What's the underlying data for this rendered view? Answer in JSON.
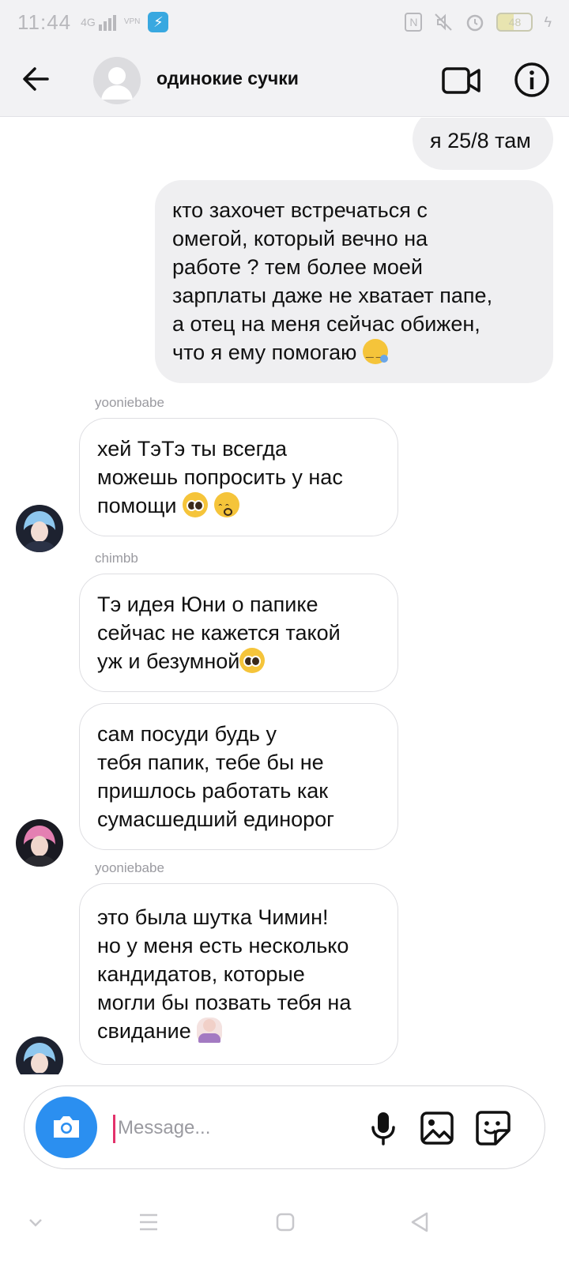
{
  "status_bar": {
    "time": "11:44",
    "signal_label": "4G",
    "vpn_label": "VPN",
    "app_icon": "telegram-x-icon",
    "battery": "48"
  },
  "header": {
    "title": "одинокие сучки",
    "back_icon": "arrow-left-icon",
    "video_icon": "video-camera-icon",
    "info_icon": "info-icon"
  },
  "messages": [
    {
      "type": "sent",
      "lines": [
        "я 25/8 там"
      ]
    },
    {
      "type": "sent",
      "lines": [
        "кто захочет встречаться с",
        "омегой, который вечно на",
        "работе ? тем более моей",
        "зарплаты даже не хватает папе,",
        "а отец на меня сейчас обижен,",
        "что я ему помогаю"
      ]
    },
    {
      "sender": "yooniebabe",
      "type": "received",
      "lines": [
        "хей ТэТэ ты всегда",
        "можешь попросить у нас",
        "помощи"
      ]
    },
    {
      "sender": "chimbb",
      "type": "received",
      "lines": [
        "Тэ идея Юни о папике",
        "сейчас не кажется такой",
        "уж и безумной"
      ]
    },
    {
      "type": "received",
      "lines": [
        "сам посуди будь у",
        "тебя папик, тебе бы не",
        "пришлось работать как",
        "сумасшедший единорог"
      ]
    },
    {
      "sender": "yooniebabe",
      "type": "received",
      "lines": [
        "это была шутка Чимин!",
        "но у меня есть несколько",
        "кандидатов, которые",
        "могли бы позвать тебя на",
        "свидание"
      ]
    }
  ],
  "composer": {
    "placeholder": "Message..."
  },
  "colors": {
    "accent_blue": "#2b8ff0",
    "cursor_pink": "#e3326b",
    "sent_bubble": "#efeff1",
    "header_bg": "#f2f2f4"
  }
}
